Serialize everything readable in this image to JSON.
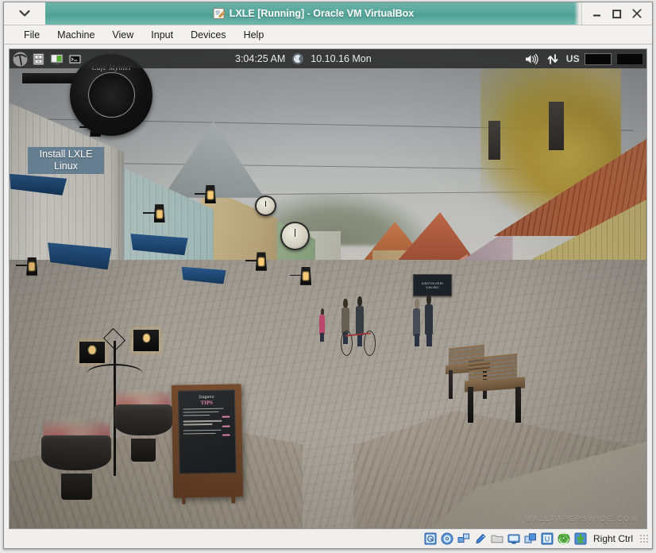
{
  "window": {
    "title": "LXLE [Running] - Oracle VM VirtualBox",
    "title_icon": "virtualbox-vm-icon",
    "menu_button_icon": "chevron-down-icon",
    "controls": [
      {
        "name": "minimize",
        "icon": "minimize-icon",
        "glyph": "—"
      },
      {
        "name": "maximize",
        "icon": "maximize-icon",
        "glyph": "☐"
      },
      {
        "name": "close",
        "icon": "close-icon",
        "glyph": "✕"
      }
    ],
    "accent_color": "#57a79b",
    "titlebar_text_color": "#ffffff"
  },
  "menubar": {
    "items": [
      {
        "label": "File"
      },
      {
        "label": "Machine"
      },
      {
        "label": "View"
      },
      {
        "label": "Input"
      },
      {
        "label": "Devices"
      },
      {
        "label": "Help"
      }
    ]
  },
  "guest": {
    "os_name": "LXLE",
    "panel": {
      "launchers": [
        {
          "name": "lxle-menu",
          "icon": "lxle-pickaxe-logo-icon",
          "tooltip": "Menu"
        },
        {
          "name": "file-manager",
          "icon": "file-cabinet-icon",
          "tooltip": "File Manager"
        },
        {
          "name": "show-desktop",
          "icon": "monitor-desktop-icon",
          "tooltip": "Show Desktop"
        },
        {
          "name": "terminal",
          "icon": "terminal-icon",
          "tooltip": "Terminal"
        }
      ],
      "clock_time": "3:04:25 AM",
      "clock_date": "10.10.16 Mon",
      "weather_icon": "weather-moon-icon",
      "tray": [
        {
          "name": "volume",
          "icon": "speaker-volume-icon"
        },
        {
          "name": "network",
          "icon": "network-up-down-arrows-icon"
        }
      ],
      "keyboard_layout": "US",
      "workspaces": [
        {
          "name": "workspace-1",
          "active": true
        },
        {
          "name": "workspace-2",
          "active": false
        }
      ],
      "background_color": "#262626"
    },
    "desktop_icons": [
      {
        "name": "install-lxle-linux",
        "label_line1": "Install LXLE",
        "label_line2": "Linux",
        "selected": true,
        "selection_color": "#5a768c"
      }
    ],
    "wallpaper": {
      "description": "Old town cobblestone street with wooden houses, Sweden",
      "cafe_sign_text": "Café Myntet",
      "shop_sign_line1": "GÄSTGIVERI",
      "shop_sign_line2": "CALÖKI",
      "chalkboard_header": "Dagens",
      "chalkboard_title": "TIPS",
      "watermark": "WALLPAPERSWIDE.COM"
    }
  },
  "statusbar": {
    "icons": [
      {
        "name": "hard-disk",
        "icon": "hard-disk-icon"
      },
      {
        "name": "optical-drive",
        "icon": "cd-dvd-icon"
      },
      {
        "name": "network-adapters",
        "icon": "network-adapter-icon"
      },
      {
        "name": "usb-devices",
        "icon": "usb-plug-icon"
      },
      {
        "name": "shared-folders",
        "icon": "folder-icon"
      },
      {
        "name": "display",
        "icon": "display-monitor-icon"
      },
      {
        "name": "video-capture",
        "icon": "video-capture-icon"
      },
      {
        "name": "remote-desktop",
        "icon": "vrdp-icon"
      },
      {
        "name": "mouse-integration",
        "icon": "mouse-pointer-globe-icon"
      },
      {
        "name": "guest-additions",
        "icon": "guest-additions-download-icon"
      }
    ],
    "host_key_label": "Right Ctrl",
    "resize_grip_icon": "resize-grip-icon"
  }
}
